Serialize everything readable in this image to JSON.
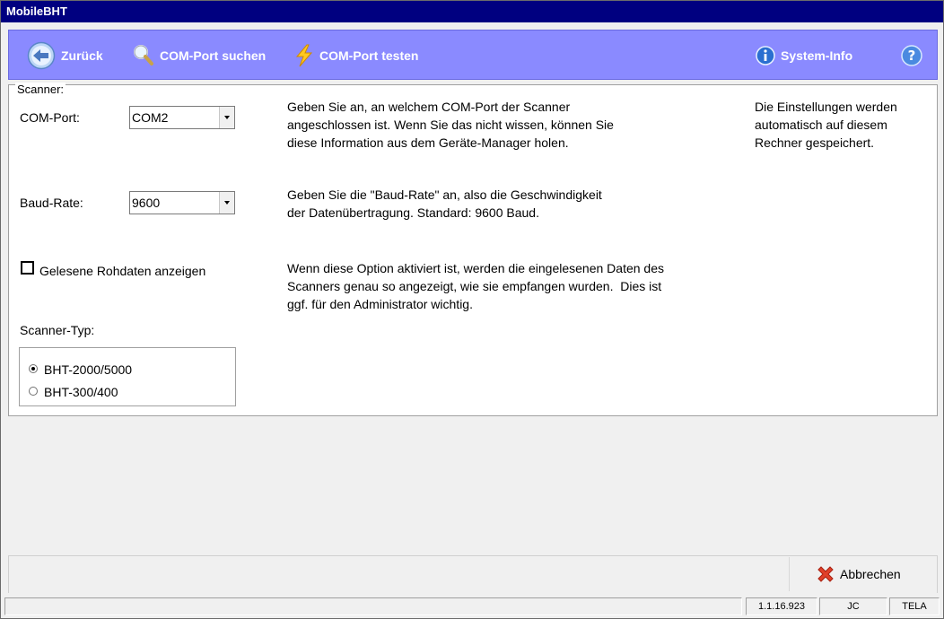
{
  "window": {
    "title": "MobileBHT"
  },
  "toolbar": {
    "back_label": "Zurück",
    "search_label": "COM-Port suchen",
    "test_label": "COM-Port testen",
    "sysinfo_label": "System-Info",
    "colors": {
      "background": "#8a8aff",
      "text": "#ffffff"
    }
  },
  "scanner": {
    "group_label": "Scanner:",
    "com_port": {
      "label": "COM-Port:",
      "value": "COM2",
      "description": [
        "Geben Sie an, an welchem COM-Port der Scanner",
        "angeschlossen ist. Wenn Sie das nicht wissen, können Sie",
        "diese Information aus dem Geräte-Manager holen."
      ]
    },
    "baud_rate": {
      "label": "Baud-Rate:",
      "value": "9600",
      "description": [
        "Geben Sie die \"Baud-Rate\" an, also die Geschwindigkeit",
        "der Datenübertragung. Standard: 9600 Baud."
      ]
    },
    "raw_data": {
      "label": "Gelesene Rohdaten anzeigen",
      "checked": false,
      "description": [
        "Wenn diese Option aktiviert ist, werden die eingelesenen Daten des",
        "Scanners genau so angezeigt, wie sie empfangen wurden.  Dies ist",
        "ggf. für den Administrator wichtig."
      ]
    },
    "type": {
      "label": "Scanner-Typ:",
      "options": [
        {
          "label": "BHT-2000/5000",
          "selected": true
        },
        {
          "label": "BHT-300/400",
          "selected": false
        }
      ]
    },
    "note": [
      "Die Einstellungen werden",
      "automatisch auf diesem",
      "Rechner gespeichert."
    ]
  },
  "footer": {
    "cancel_label": "Abbrechen"
  },
  "status": {
    "version": "1.1.16.923",
    "user": "JC",
    "location": "TELA"
  },
  "icons": {
    "back": "arrow-left-icon",
    "search": "magnifier-icon",
    "test": "lightning-icon",
    "info": "info-icon",
    "help": "help-icon",
    "cancel": "red-x-icon"
  }
}
